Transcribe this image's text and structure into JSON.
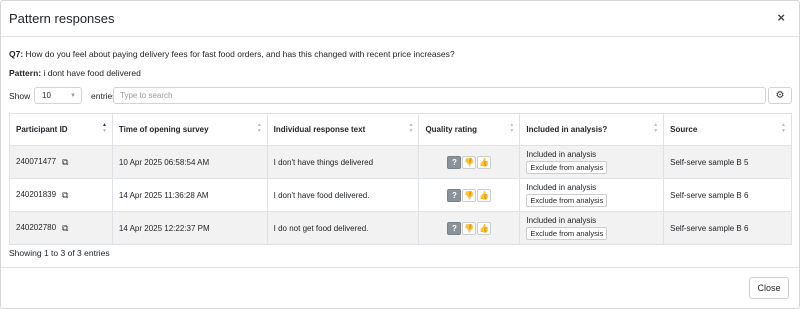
{
  "modal": {
    "title": "Pattern responses",
    "close_glyph": "×"
  },
  "question": {
    "label": "Q7:",
    "text": "How do you feel about paying delivery fees for fast food orders, and has this changed with recent price increases?"
  },
  "pattern": {
    "label": "Pattern:",
    "text": "i dont have food delivered"
  },
  "controls": {
    "show_label": "Show",
    "page_length": "10",
    "entries_label": "entries",
    "search_placeholder": "Type to search",
    "settings_icon": "gear-icon"
  },
  "table": {
    "columns": [
      "Participant ID",
      "Time of opening survey",
      "Individual response text",
      "Quality rating",
      "Included in analysis?",
      "Source"
    ],
    "sorted_column": "Participant ID",
    "rows": [
      {
        "participant_id": "240071477",
        "time": "10 Apr 2025 06:58:54 AM",
        "response": "I don't have things delivered",
        "quality": "?",
        "included": "Included in analysis",
        "exclude_label": "Exclude from analysis",
        "source": "Self-serve sample B 5"
      },
      {
        "participant_id": "240201839",
        "time": "14 Apr 2025 11:36:28 AM",
        "response": "I don't have food delivered.",
        "quality": "?",
        "included": "Included in analysis",
        "exclude_label": "Exclude from analysis",
        "source": "Self-serve sample B 6"
      },
      {
        "participant_id": "240202780",
        "time": "14 Apr 2025 12:22:37 PM",
        "response": "I do not get food delivered.",
        "quality": "?",
        "included": "Included in analysis",
        "exclude_label": "Exclude from analysis",
        "source": "Self-serve sample B 6"
      }
    ]
  },
  "info": "Showing 1 to 3 of 3 entries",
  "footer": {
    "close_label": "Close"
  }
}
